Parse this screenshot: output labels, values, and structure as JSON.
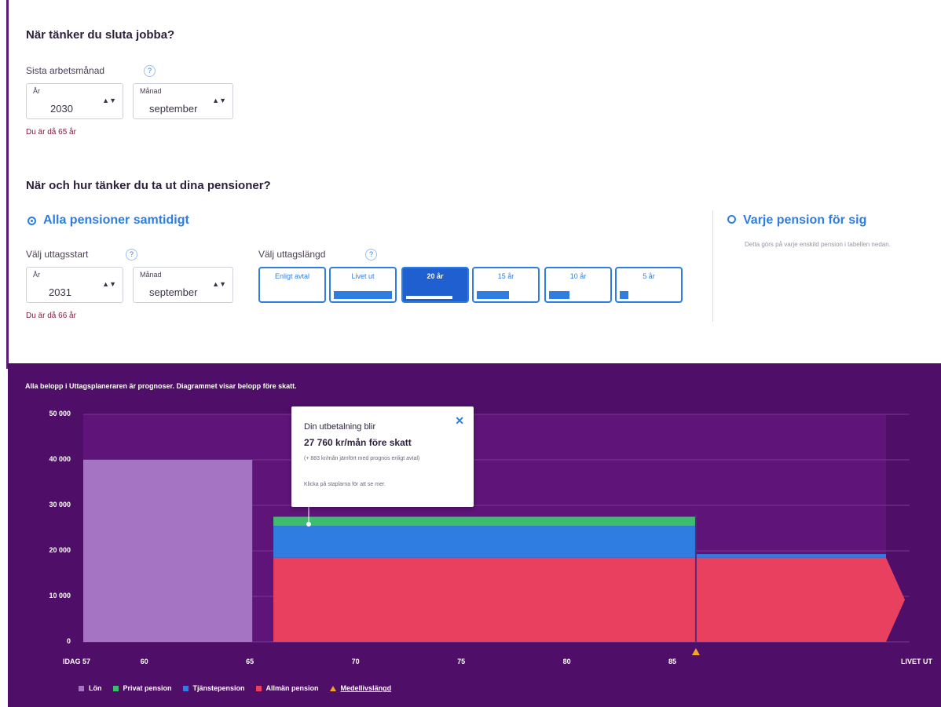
{
  "retire": {
    "title": "När tänker du sluta jobba?",
    "last_month_label": "Sista arbetsmånad",
    "help": "?",
    "year_small": "År",
    "year_value": "2030",
    "month_small": "Månad",
    "month_value": "september",
    "age_note": "Du är då 65 år"
  },
  "withdraw": {
    "title": "När och hur tänker du ta ut dina pensioner?",
    "option_all": "Alla pensioner samtidigt",
    "option_each": "Varje pension för sig",
    "option_each_hint": "Detta görs på varje enskild pension i tabellen nedan.",
    "start_label": "Välj uttagsstart",
    "length_label": "Välj uttagslängd",
    "help": "?",
    "year_small": "År",
    "year_value": "2031",
    "month_small": "Månad",
    "month_value": "september",
    "age_note": "Du är då 66 år",
    "lengths": [
      {
        "label": "Enligt avtal",
        "fill": 0
      },
      {
        "label": "Livet ut",
        "fill": 1.0
      },
      {
        "label": "20 år",
        "fill": 0.8,
        "active": true
      },
      {
        "label": "15 år",
        "fill": 0.55
      },
      {
        "label": "10 år",
        "fill": 0.35
      },
      {
        "label": "5 år",
        "fill": 0.15
      }
    ]
  },
  "tooltip": {
    "line1": "Din utbetalning blir",
    "line2": "27 760 kr/mån före skatt",
    "line3": "(+ 883 kr/mån jämfört med prognos enligt avtal)",
    "line4": "Klicka på staplarna för att se mer."
  },
  "disclaimer": "Alla belopp i Uttagsplaneraren är prognoser. Diagrammet visar belopp före skatt.",
  "colors": {
    "panel": "#4f0e68",
    "lon": "#a574c2",
    "privat": "#3ebd6e",
    "tjanste": "#2f7de1",
    "allman": "#e8405e",
    "medel": "#f5a623"
  },
  "chart_data": {
    "type": "area",
    "ylim": [
      0,
      50000
    ],
    "yticks": [
      "0",
      "10 000",
      "20 000",
      "30 000",
      "40 000",
      "50 000"
    ],
    "xticks": [
      {
        "label": "IDAG 57",
        "age": 57
      },
      {
        "label": "60",
        "age": 60
      },
      {
        "label": "65",
        "age": 65
      },
      {
        "label": "70",
        "age": 70
      },
      {
        "label": "75",
        "age": 75
      },
      {
        "label": "80",
        "age": 80
      },
      {
        "label": "85",
        "age": 85
      },
      {
        "label": "LIVET UT",
        "age": 95
      }
    ],
    "x_range": [
      57,
      95
    ],
    "segments": [
      {
        "from": 57,
        "to": 65,
        "allman": 0,
        "tjanste": 0,
        "privat": 0,
        "lon": 40000
      },
      {
        "from": 66,
        "to": 86,
        "allman": 18500,
        "tjanste": 7000,
        "privat": 2000,
        "lon": 0
      },
      {
        "from": 86,
        "to": 95,
        "allman": 18500,
        "tjanste": 800,
        "privat": 0,
        "lon": 0
      }
    ],
    "medellivslangd_age": 86,
    "legend": [
      {
        "name": "Lön",
        "color": "#a574c2"
      },
      {
        "name": "Privat pension",
        "color": "#3ebd6e"
      },
      {
        "name": "Tjänstepension",
        "color": "#2f7de1"
      },
      {
        "name": "Allmän pension",
        "color": "#e8405e"
      },
      {
        "name": "Medellivslängd",
        "color": "#f5a623",
        "marker": "triangle"
      }
    ]
  }
}
